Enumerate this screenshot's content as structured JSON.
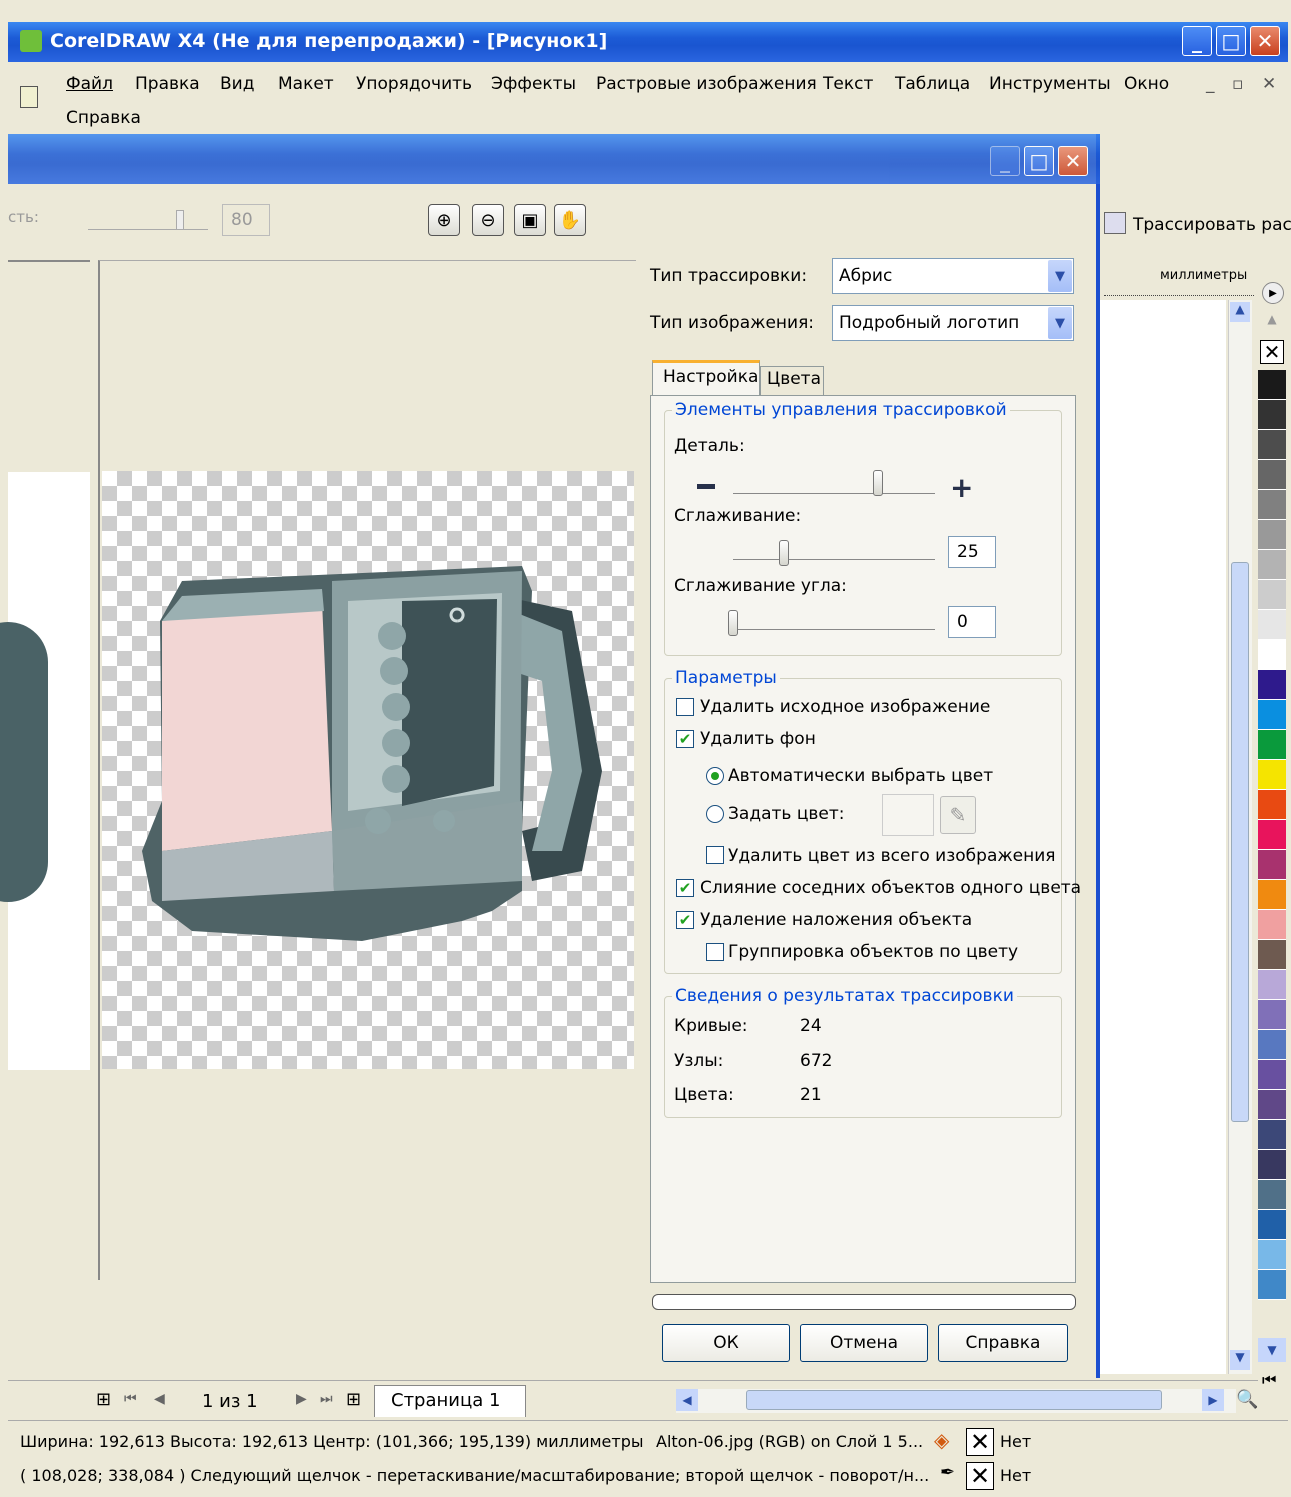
{
  "app": {
    "title": "CorelDRAW X4 (Не для перепродажи) - [Рисунок1]",
    "menu": [
      "Файл",
      "Правка",
      "Вид",
      "Макет",
      "Упорядочить",
      "Эффекты",
      "Растровые изображения",
      "Текст",
      "Таблица",
      "Инструменты",
      "Окно",
      "Справка"
    ],
    "trace_button": "Трассировать раст",
    "ruler_unit": "миллиметры"
  },
  "dialog": {
    "opacity_label": "сть:",
    "opacity_value": "80",
    "trace_type_label": "Тип трассировки:",
    "trace_type_value": "Абрис",
    "image_type_label": "Тип изображения:",
    "image_type_value": "Подробный логотип",
    "tabs": [
      "Настройка",
      "Цвета"
    ],
    "controls_group": "Элементы управления трассировкой",
    "detail_label": "Деталь:",
    "detail_level": 0.72,
    "smoothing_label": "Сглаживание:",
    "smoothing_value": "25",
    "corner_label": "Сглаживание угла:",
    "corner_value": "0",
    "params_group": "Параметры",
    "opt_delete_original": "Удалить исходное изображение",
    "opt_delete_original_checked": false,
    "opt_remove_bg": "Удалить фон",
    "opt_remove_bg_checked": true,
    "opt_auto_color": "Автоматически выбрать цвет",
    "opt_set_color": "Задать цвет:",
    "opt_remove_color_all": "Удалить цвет из всего изображения",
    "opt_merge": "Слияние соседних объектов одного цвета",
    "opt_merge_checked": true,
    "opt_overlap": "Удаление наложения объекта",
    "opt_overlap_checked": true,
    "opt_group": "Группировка объектов по цвету",
    "opt_group_checked": false,
    "results_group": "Сведения о результатах трассировки",
    "curves_label": "Кривые:",
    "curves_value": "24",
    "nodes_label": "Узлы:",
    "nodes_value": "672",
    "colors_label": "Цвета:",
    "colors_value": "21",
    "ok": "ОК",
    "cancel": "Отмена",
    "help": "Справка"
  },
  "page_nav": {
    "counter": "1 из 1",
    "page_tab": "Страница 1"
  },
  "status": {
    "line1": "Ширина: 192,613 Высота: 192,613 Центр: (101,366; 195,139) миллиметры",
    "object_info": "Alton-06.jpg (RGB) on Слой 1 5...",
    "fill_none": "Нет",
    "line2": "( 108,028; 338,084 )   Следующий щелчок - перетаскивание/масштабирование; второй щелчок - поворот/н...",
    "outline_none": "Нет"
  },
  "palette": [
    "#1a1a1a",
    "#333333",
    "#4d4d4d",
    "#666666",
    "#808080",
    "#999999",
    "#b3b3b3",
    "#cccccc",
    "#e6e6e6",
    "#ffffff",
    "#2e1a8c",
    "#0a8fe0",
    "#0a9a3c",
    "#f5e400",
    "#e84a12",
    "#e8145c",
    "#a8326e",
    "#f08a10",
    "#f0a0a0",
    "#6e5a50",
    "#b8a8d8",
    "#8070b8",
    "#5878c0",
    "#6850a0",
    "#604888",
    "#3c4878",
    "#383860",
    "#507088",
    "#2060a8",
    "#78b8e8",
    "#4088c8"
  ]
}
